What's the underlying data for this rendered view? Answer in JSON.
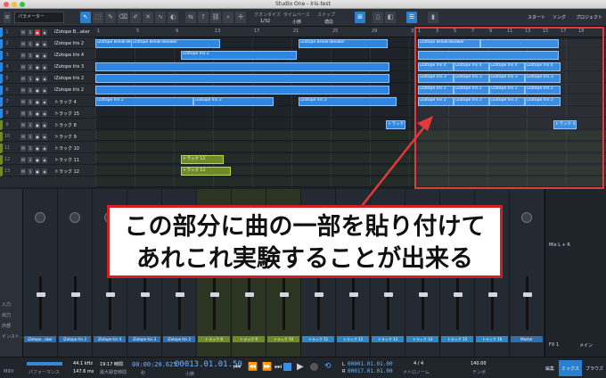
{
  "window": {
    "title": "Studio One - Iris-test"
  },
  "toolbar": {
    "parameter_label": "パラメーター",
    "quantize_label": "クオンタイズ",
    "quantize_value": "1/32",
    "timebase_label": "タイムベース",
    "timebase_value": "小節",
    "snap_label": "スナップ",
    "snap_value": "適応",
    "start_label": "スタート",
    "song_label": "ソング",
    "project_label": "プロジェクト"
  },
  "tracks": [
    {
      "num": "1",
      "name": "iZotope B...aker"
    },
    {
      "num": "2",
      "name": "iZotope Iris 2"
    },
    {
      "num": "3",
      "name": "iZotope Iris 4"
    },
    {
      "num": "4",
      "name": "iZotope Iris 3"
    },
    {
      "num": "5",
      "name": "iZotope Iris 2"
    },
    {
      "num": "6",
      "name": "iZotope Iris 2"
    },
    {
      "num": "7",
      "name": "トラック 4"
    },
    {
      "num": "8",
      "name": "トラック 15"
    },
    {
      "num": "9",
      "name": "トラック 8"
    },
    {
      "num": "10",
      "name": "トラック 9"
    },
    {
      "num": "11",
      "name": "トラック 10"
    },
    {
      "num": "12",
      "name": "トラック 11"
    },
    {
      "num": "13",
      "name": "トラック 12"
    }
  ],
  "ruler": {
    "left": [
      "1",
      "5",
      "9",
      "13",
      "17",
      "21",
      "25",
      "29",
      "33"
    ],
    "right": [
      "1",
      "3",
      "5",
      "7",
      "9",
      "11",
      "13",
      "15",
      "17",
      "18"
    ]
  },
  "clips": {
    "breaktweaker": "iZotope BreakTweaker",
    "iris2": "iZotope Iris 2",
    "iris4": "iZotope Iris 4",
    "iris3": "iZotope Iris 3",
    "track4": "トラック 4",
    "track12": "トラック 12",
    "track13": "トラック 13"
  },
  "mixer": {
    "send_label": "センド",
    "out_label": "出力",
    "in_label": "入力",
    "stereo_out": "Stereo Out",
    "bus2": "バス 2",
    "main": "メイン",
    "strip_names": [
      "iZotope...aker",
      "iZotope Iris 2",
      "iZotope Iris 4",
      "iZotope Iris 3",
      "iZotope Iris 2",
      "トラック 8",
      "トラック 9",
      "トラック 10",
      "トラック 11",
      "トラック 12",
      "トラック 13",
      "トラック 14",
      "トラック 15",
      "トラック 16",
      "Master"
    ],
    "sidebar": [
      "入力",
      "出力",
      "外部",
      "インスト..."
    ],
    "fx1": "FX 1",
    "main_right": "メイン",
    "mix_lr": "Mix L + R"
  },
  "transport": {
    "midi": "MIDI",
    "perf": "パフォーマンス",
    "rate": "44.1 kHz",
    "latency": "147.6 ms",
    "time": "19:17 時間",
    "rec_max": "最大録音時間",
    "pos1": "00:00:20.625",
    "pos_sec": "秒",
    "pos2": "00013.01.01.50",
    "pos_bar": "小節",
    "loop_l": "00001.01.01.00",
    "loop_r": "00017.01.01.00",
    "sig": "4 / 4",
    "metro": "メトロノーム",
    "tempo": "140.00",
    "tempo_label": "テンポ",
    "edit": "編集",
    "mix": "ミックス",
    "browse": "ブラウズ"
  },
  "annotation": {
    "line1": "この部分に曲の一部を貼り付けて",
    "line2": "あれこれ実験することが出来る"
  },
  "colors": {
    "clip_blue": "#2f86e0",
    "clip_green": "#6f8a28",
    "highlight_red": "#e23a3a",
    "accent": "#2a7fd0"
  }
}
